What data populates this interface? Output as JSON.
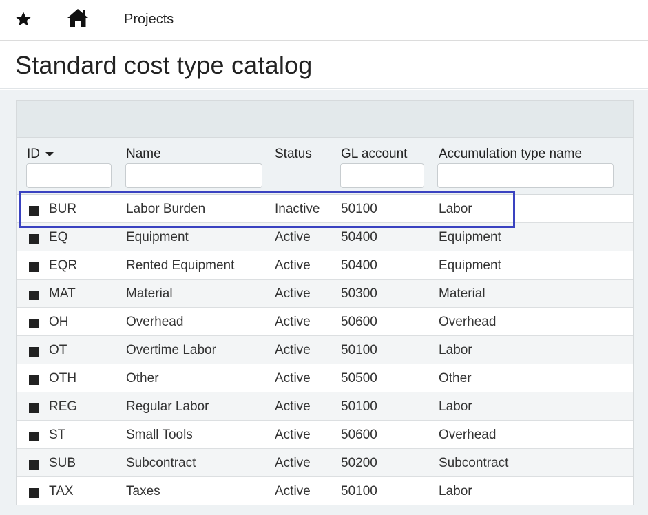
{
  "nav": {
    "favorites_icon": "star-icon",
    "home_icon": "home-icon",
    "projects_label": "Projects"
  },
  "page": {
    "title": "Standard cost type catalog"
  },
  "grid": {
    "columns": {
      "id": "ID",
      "name": "Name",
      "status": "Status",
      "gl_account": "GL account",
      "accumulation": "Accumulation type name"
    },
    "sort": {
      "column": "ID",
      "direction": "descending-arrow"
    },
    "filters": {
      "id": "",
      "name": "",
      "status": "",
      "gl_account": "",
      "accumulation": ""
    },
    "rows": [
      {
        "id": "BUR",
        "name": "Labor Burden",
        "status": "Inactive",
        "gl": "50100",
        "acc": "Labor"
      },
      {
        "id": "EQ",
        "name": "Equipment",
        "status": "Active",
        "gl": "50400",
        "acc": "Equipment"
      },
      {
        "id": "EQR",
        "name": "Rented Equipment",
        "status": "Active",
        "gl": "50400",
        "acc": "Equipment"
      },
      {
        "id": "MAT",
        "name": "Material",
        "status": "Active",
        "gl": "50300",
        "acc": "Material"
      },
      {
        "id": "OH",
        "name": "Overhead",
        "status": "Active",
        "gl": "50600",
        "acc": "Overhead"
      },
      {
        "id": "OT",
        "name": "Overtime Labor",
        "status": "Active",
        "gl": "50100",
        "acc": "Labor"
      },
      {
        "id": "OTH",
        "name": "Other",
        "status": "Active",
        "gl": "50500",
        "acc": "Other"
      },
      {
        "id": "REG",
        "name": "Regular Labor",
        "status": "Active",
        "gl": "50100",
        "acc": "Labor"
      },
      {
        "id": "ST",
        "name": "Small Tools",
        "status": "Active",
        "gl": "50600",
        "acc": "Overhead"
      },
      {
        "id": "SUB",
        "name": "Subcontract",
        "status": "Active",
        "gl": "50200",
        "acc": "Subcontract"
      },
      {
        "id": "TAX",
        "name": "Taxes",
        "status": "Active",
        "gl": "50100",
        "acc": "Labor"
      }
    ]
  },
  "colors": {
    "highlight_border": "#3a42c0",
    "toolbar_bg": "#e3e9eb",
    "header_bg": "#eef2f4"
  }
}
